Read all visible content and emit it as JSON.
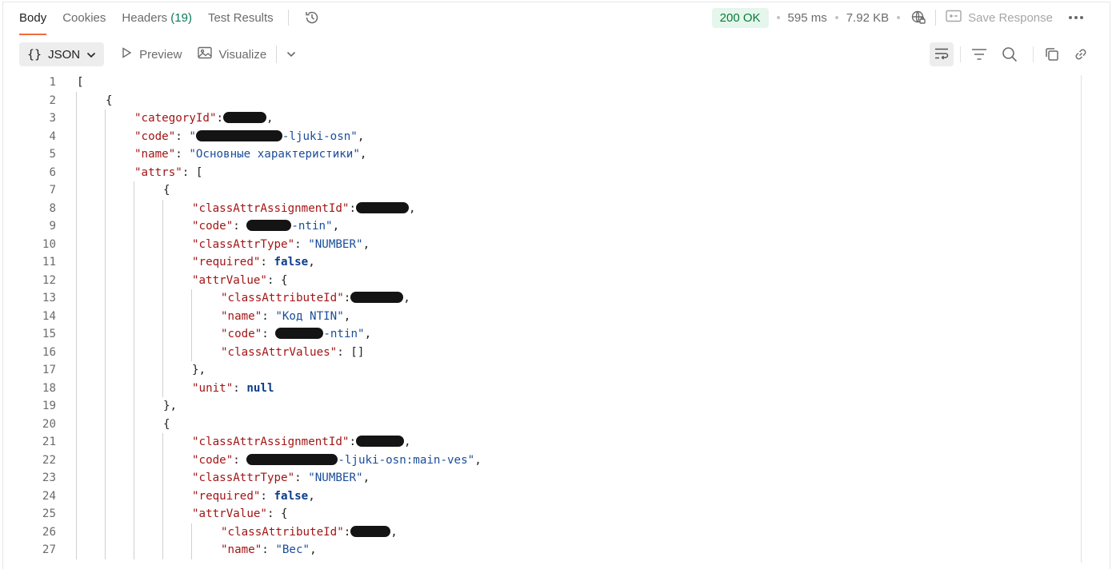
{
  "tabs": [
    {
      "label": "Body",
      "active": true
    },
    {
      "label": "Cookies",
      "active": false
    },
    {
      "label": "Headers",
      "count": "(19)",
      "active": false
    },
    {
      "label": "Test Results",
      "active": false
    }
  ],
  "status": {
    "code": "200 OK",
    "time": "595 ms",
    "size": "7.92 KB",
    "save_label": "Save Response"
  },
  "toolbar": {
    "format_brace": "{}",
    "format_label": "JSON",
    "preview_label": "Preview",
    "visualize_label": "Visualize"
  },
  "icons": {
    "history": "history-icon",
    "globe": "globe-icon",
    "save": "save-response-icon",
    "more": "more-icon",
    "wrap": "wrap-lines-icon",
    "filter": "filter-icon",
    "search": "search-icon",
    "copy": "copy-icon",
    "link": "link-icon"
  },
  "colors": {
    "accent": "#f26b3a",
    "status_bg": "#e5f6ec",
    "status_text": "#0a7a3c",
    "key": "#a31515",
    "string": "#1a4d99",
    "keyword": "#0c3d8a"
  },
  "lines": [
    {
      "n": "1",
      "indent": 0,
      "tokens": [
        {
          "t": "p",
          "v": "["
        }
      ]
    },
    {
      "n": "2",
      "indent": 1,
      "tokens": [
        {
          "t": "p",
          "v": "{"
        }
      ]
    },
    {
      "n": "3",
      "indent": 2,
      "tokens": [
        {
          "t": "k",
          "v": "\"categoryId\""
        },
        {
          "t": "p",
          "v": ":"
        },
        {
          "t": "r",
          "w": 54
        },
        {
          "t": "p",
          "v": ","
        }
      ]
    },
    {
      "n": "4",
      "indent": 2,
      "tokens": [
        {
          "t": "k",
          "v": "\"code\""
        },
        {
          "t": "p",
          "v": ": "
        },
        {
          "t": "s",
          "v": "\""
        },
        {
          "t": "r",
          "w": 108
        },
        {
          "t": "s",
          "v": "-ljuki-osn\""
        },
        {
          "t": "p",
          "v": ","
        }
      ]
    },
    {
      "n": "5",
      "indent": 2,
      "tokens": [
        {
          "t": "k",
          "v": "\"name\""
        },
        {
          "t": "p",
          "v": ": "
        },
        {
          "t": "s",
          "v": "\"Основные характеристики\""
        },
        {
          "t": "p",
          "v": ","
        }
      ]
    },
    {
      "n": "6",
      "indent": 2,
      "tokens": [
        {
          "t": "k",
          "v": "\"attrs\""
        },
        {
          "t": "p",
          "v": ": ["
        }
      ]
    },
    {
      "n": "7",
      "indent": 3,
      "tokens": [
        {
          "t": "p",
          "v": "{"
        }
      ]
    },
    {
      "n": "8",
      "indent": 4,
      "tokens": [
        {
          "t": "k",
          "v": "\"classAttrAssignmentId\""
        },
        {
          "t": "p",
          "v": ":"
        },
        {
          "t": "r",
          "w": 66
        },
        {
          "t": "p",
          "v": ","
        }
      ]
    },
    {
      "n": "9",
      "indent": 4,
      "tokens": [
        {
          "t": "k",
          "v": "\"code\""
        },
        {
          "t": "p",
          "v": ": "
        },
        {
          "t": "r",
          "w": 56
        },
        {
          "t": "s",
          "v": "-ntin\""
        },
        {
          "t": "p",
          "v": ","
        }
      ]
    },
    {
      "n": "10",
      "indent": 4,
      "tokens": [
        {
          "t": "k",
          "v": "\"classAttrType\""
        },
        {
          "t": "p",
          "v": ": "
        },
        {
          "t": "s",
          "v": "\"NUMBER\""
        },
        {
          "t": "p",
          "v": ","
        }
      ]
    },
    {
      "n": "11",
      "indent": 4,
      "tokens": [
        {
          "t": "k",
          "v": "\"required\""
        },
        {
          "t": "p",
          "v": ": "
        },
        {
          "t": "kw",
          "v": "false"
        },
        {
          "t": "p",
          "v": ","
        }
      ]
    },
    {
      "n": "12",
      "indent": 4,
      "tokens": [
        {
          "t": "k",
          "v": "\"attrValue\""
        },
        {
          "t": "p",
          "v": ": {"
        }
      ]
    },
    {
      "n": "13",
      "indent": 5,
      "tokens": [
        {
          "t": "k",
          "v": "\"classAttributeId\""
        },
        {
          "t": "p",
          "v": ":"
        },
        {
          "t": "r",
          "w": 66
        },
        {
          "t": "p",
          "v": ","
        }
      ]
    },
    {
      "n": "14",
      "indent": 5,
      "tokens": [
        {
          "t": "k",
          "v": "\"name\""
        },
        {
          "t": "p",
          "v": ": "
        },
        {
          "t": "s",
          "v": "\"Код NTIN\""
        },
        {
          "t": "p",
          "v": ","
        }
      ]
    },
    {
      "n": "15",
      "indent": 5,
      "tokens": [
        {
          "t": "k",
          "v": "\"code\""
        },
        {
          "t": "p",
          "v": ": "
        },
        {
          "t": "r",
          "w": 60
        },
        {
          "t": "s",
          "v": "-ntin\""
        },
        {
          "t": "p",
          "v": ","
        }
      ]
    },
    {
      "n": "16",
      "indent": 5,
      "tokens": [
        {
          "t": "k",
          "v": "\"classAttrValues\""
        },
        {
          "t": "p",
          "v": ": []"
        }
      ]
    },
    {
      "n": "17",
      "indent": 4,
      "tokens": [
        {
          "t": "p",
          "v": "},"
        }
      ]
    },
    {
      "n": "18",
      "indent": 4,
      "tokens": [
        {
          "t": "k",
          "v": "\"unit\""
        },
        {
          "t": "p",
          "v": ": "
        },
        {
          "t": "kw",
          "v": "null"
        }
      ]
    },
    {
      "n": "19",
      "indent": 3,
      "tokens": [
        {
          "t": "p",
          "v": "},"
        }
      ]
    },
    {
      "n": "20",
      "indent": 3,
      "tokens": [
        {
          "t": "p",
          "v": "{"
        }
      ]
    },
    {
      "n": "21",
      "indent": 4,
      "tokens": [
        {
          "t": "k",
          "v": "\"classAttrAssignmentId\""
        },
        {
          "t": "p",
          "v": ":"
        },
        {
          "t": "r",
          "w": 60
        },
        {
          "t": "p",
          "v": ","
        }
      ]
    },
    {
      "n": "22",
      "indent": 4,
      "tokens": [
        {
          "t": "k",
          "v": "\"code\""
        },
        {
          "t": "p",
          "v": ": "
        },
        {
          "t": "r",
          "w": 114
        },
        {
          "t": "s",
          "v": "-ljuki-osn:main-ves\""
        },
        {
          "t": "p",
          "v": ","
        }
      ]
    },
    {
      "n": "23",
      "indent": 4,
      "tokens": [
        {
          "t": "k",
          "v": "\"classAttrType\""
        },
        {
          "t": "p",
          "v": ": "
        },
        {
          "t": "s",
          "v": "\"NUMBER\""
        },
        {
          "t": "p",
          "v": ","
        }
      ]
    },
    {
      "n": "24",
      "indent": 4,
      "tokens": [
        {
          "t": "k",
          "v": "\"required\""
        },
        {
          "t": "p",
          "v": ": "
        },
        {
          "t": "kw",
          "v": "false"
        },
        {
          "t": "p",
          "v": ","
        }
      ]
    },
    {
      "n": "25",
      "indent": 4,
      "tokens": [
        {
          "t": "k",
          "v": "\"attrValue\""
        },
        {
          "t": "p",
          "v": ": {"
        }
      ]
    },
    {
      "n": "26",
      "indent": 5,
      "tokens": [
        {
          "t": "k",
          "v": "\"classAttributeId\""
        },
        {
          "t": "p",
          "v": ":"
        },
        {
          "t": "r",
          "w": 50
        },
        {
          "t": "p",
          "v": ","
        }
      ]
    },
    {
      "n": "27",
      "indent": 5,
      "tokens": [
        {
          "t": "k",
          "v": "\"name\""
        },
        {
          "t": "p",
          "v": ": "
        },
        {
          "t": "s",
          "v": "\"Вес\""
        },
        {
          "t": "p",
          "v": ","
        }
      ]
    }
  ]
}
